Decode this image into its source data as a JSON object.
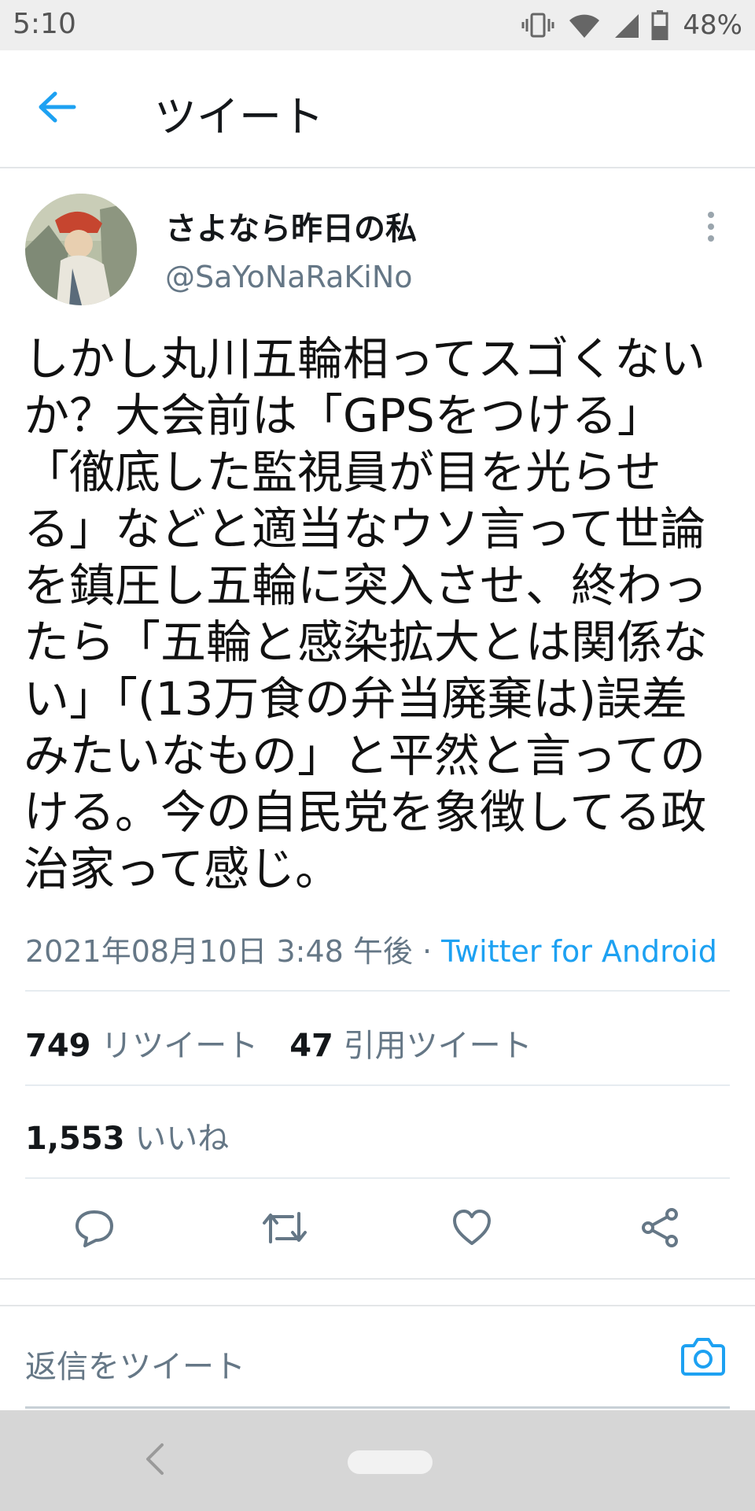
{
  "status_bar": {
    "time": "5:10",
    "battery": "48%",
    "icons": [
      "vibrate-icon",
      "wifi-icon",
      "signal-icon",
      "battery-icon"
    ]
  },
  "header": {
    "title": "ツイート",
    "back_icon": "arrow-left-icon"
  },
  "tweet": {
    "display_name": "さよなら昨日の私",
    "handle": "@SaYoNaRaKiNo",
    "text": "しかし丸川五輪相ってスゴくないか？大会前は「GPSをつける」「徹底した監視員が目を光らせる」などと適当なウソ言って世論を鎮圧し五輪に突入させ、終わったら「五輪と感染拡大とは関係ない」「(13万食の弁当廃棄は)誤差みたいなもの」と平然と言ってのける。今の自民党を象徴してる政治家って感じ。",
    "timestamp": "2021年08月10日 3:48 午後",
    "separator": " · ",
    "source": "Twitter for Android"
  },
  "stats": {
    "retweets_count": "749",
    "retweets_label": "リツイート",
    "quotes_count": "47",
    "quotes_label": "引用ツイート",
    "likes_count": "1,553",
    "likes_label": "いいね"
  },
  "actions": [
    "reply-icon",
    "retweet-icon",
    "like-icon",
    "share-icon"
  ],
  "reply": {
    "placeholder": "返信をツイート"
  },
  "colors": {
    "accent": "#1da1f2",
    "secondary_text": "#657786",
    "status_bar_bg": "#eeeeee",
    "nav_bar_bg": "#d6d6d6"
  }
}
